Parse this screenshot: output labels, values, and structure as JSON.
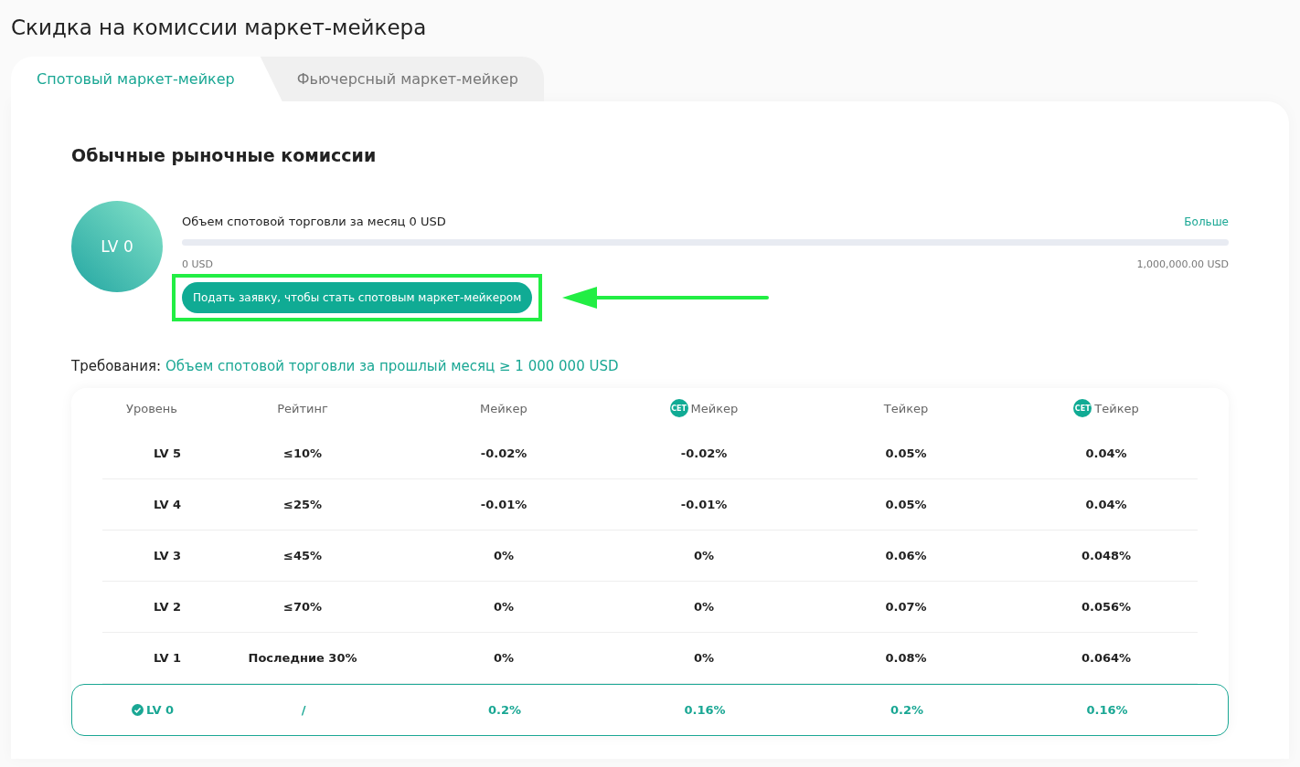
{
  "page_title": "Скидка на комиссии маркет-мейкера",
  "tabs": [
    {
      "label": "Спотовый маркет-мейкер",
      "selected": true
    },
    {
      "label": "Фьючерсный маркет-мейкер",
      "selected": false
    }
  ],
  "section_title": "Обычные рыночные комиссии",
  "level_badge": "LV 0",
  "progress": {
    "label": "Объем спотовой торговли за месяц 0 USD",
    "more_link": "Больше",
    "level": 0,
    "min_label": "0 USD",
    "max_label": "1,000,000.00 USD"
  },
  "apply_button": {
    "label": "Подать заявку, чтобы стать спотовым маркет-мейкером",
    "highlighted": true
  },
  "requirements": {
    "label": "Требования:",
    "value": "Объем спотовой торговли за прошлый месяц ≥ 1 000 000 USD"
  },
  "table": {
    "columns": [
      {
        "label": "Уровень"
      },
      {
        "label": "Рейтинг"
      },
      {
        "label": "Мейкер"
      },
      {
        "label": "Мейкер",
        "coin_badge": "CET"
      },
      {
        "label": "Тейкер"
      },
      {
        "label": "Тейкер",
        "coin_badge": "CET"
      }
    ],
    "rows": [
      {
        "cells": [
          "LV 5",
          "≤10%",
          "-0.02%",
          "-0.02%",
          "0.05%",
          "0.04%"
        ],
        "current": false
      },
      {
        "cells": [
          "LV 4",
          "≤25%",
          "-0.01%",
          "-0.01%",
          "0.05%",
          "0.04%"
        ],
        "current": false
      },
      {
        "cells": [
          "LV 3",
          "≤45%",
          "0%",
          "0%",
          "0.06%",
          "0.048%"
        ],
        "current": false
      },
      {
        "cells": [
          "LV 2",
          "≤70%",
          "0%",
          "0%",
          "0.07%",
          "0.056%"
        ],
        "current": false
      },
      {
        "cells": [
          "LV 1",
          "Последние 30%",
          "0%",
          "0%",
          "0.08%",
          "0.064%"
        ],
        "current": false
      },
      {
        "cells": [
          "LV 0",
          "/",
          "0.2%",
          "0.16%",
          "0.2%",
          "0.16%"
        ],
        "current": true
      }
    ]
  }
}
